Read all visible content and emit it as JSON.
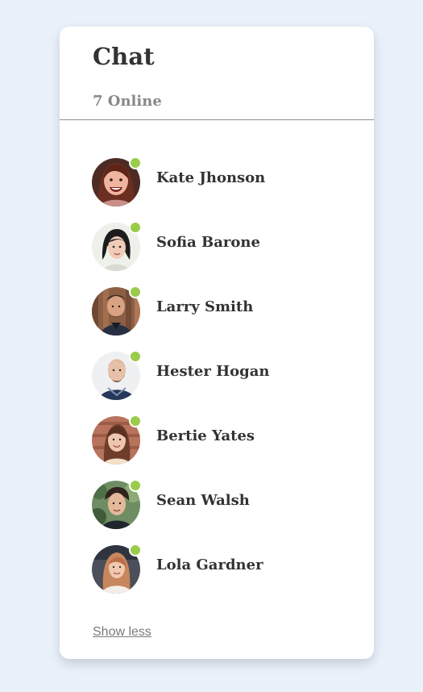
{
  "chat": {
    "title": "Chat",
    "online_label": "7 Online",
    "status_color": "#9bcb4b",
    "show_less_label": "Show less"
  },
  "contacts": [
    {
      "name": "Kate Jhonson",
      "status": "online"
    },
    {
      "name": "Sofia Barone",
      "status": "online"
    },
    {
      "name": "Larry Smith",
      "status": "online"
    },
    {
      "name": "Hester Hogan",
      "status": "online"
    },
    {
      "name": "Bertie Yates",
      "status": "online"
    },
    {
      "name": "Sean Walsh",
      "status": "online"
    },
    {
      "name": "Lola Gardner",
      "status": "online"
    }
  ]
}
